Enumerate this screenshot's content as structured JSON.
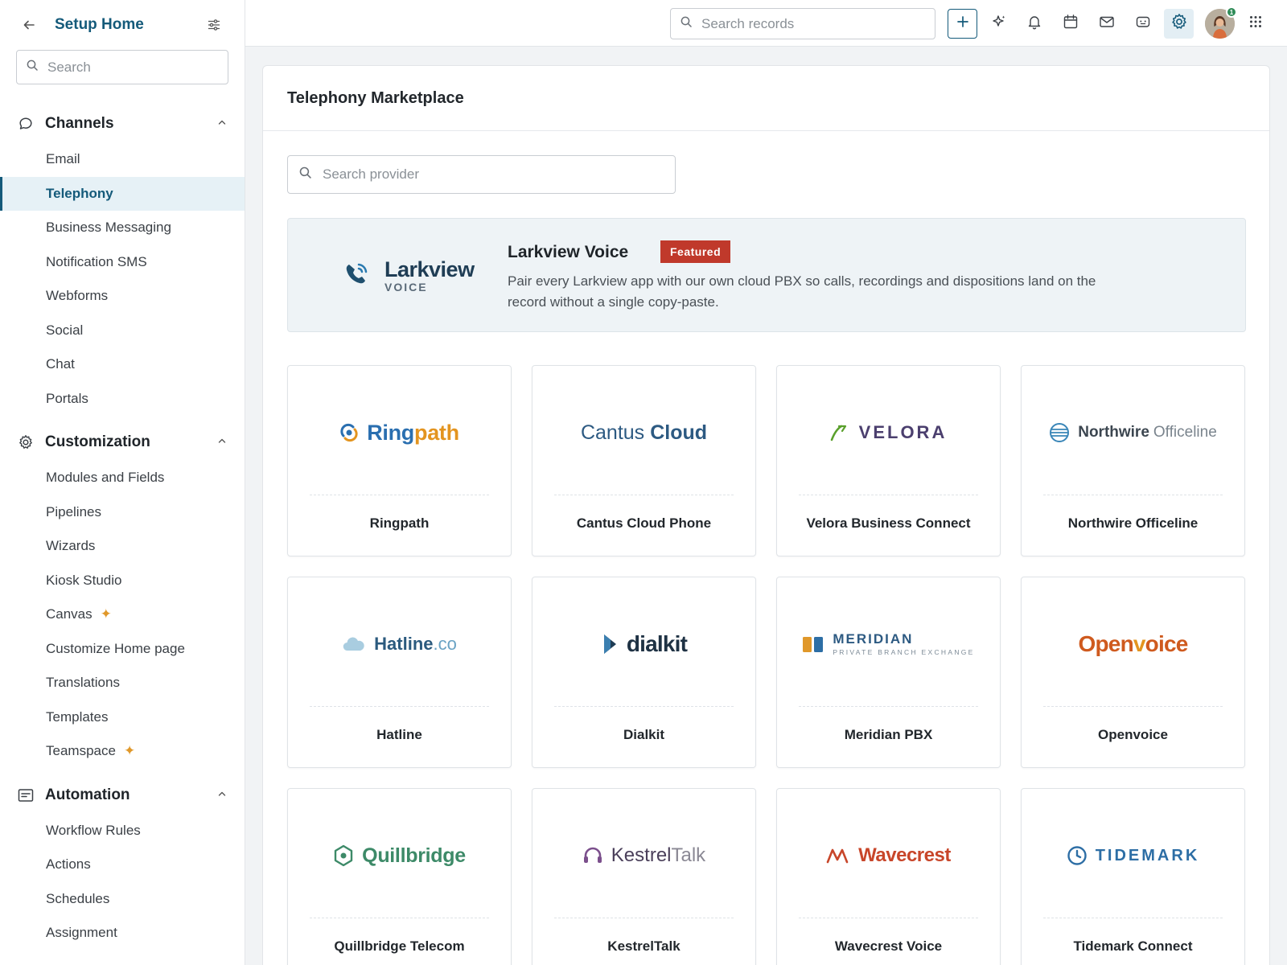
{
  "sidebar": {
    "title": "Setup Home",
    "search_placeholder": "Search",
    "sections": [
      {
        "label": "Channels",
        "items": [
          "Email",
          "Telephony",
          "Business Messaging",
          "Notification SMS",
          "Webforms",
          "Social",
          "Chat",
          "Portals"
        ]
      },
      {
        "label": "Customization",
        "items": [
          "Modules and Fields",
          "Pipelines",
          "Wizards",
          "Kiosk Studio",
          "Canvas",
          "Customize Home page",
          "Translations",
          "Templates",
          "Teamspace"
        ]
      },
      {
        "label": "Automation",
        "items": [
          "Workflow Rules",
          "Actions",
          "Schedules",
          "Assignment"
        ]
      }
    ],
    "active_item": "Telephony"
  },
  "topbar": {
    "search_placeholder": "Search records",
    "notification_count": "1"
  },
  "main": {
    "title": "Telephony Marketplace",
    "provider_search_placeholder": "Search provider",
    "featured": {
      "logo_word": "Larkview",
      "logo_sub": "VOICE",
      "name": "Larkview Voice",
      "badge": "Featured",
      "description": "Pair every Larkview app with our own cloud PBX so calls, recordings and dispositions land on the record without a single copy-paste."
    },
    "providers": [
      {
        "name": "Ringpath",
        "logo_a": "Ring",
        "logo_b": "path"
      },
      {
        "name": "Cantus Cloud Phone",
        "logo_a": "Cantus",
        "logo_b": "Cloud"
      },
      {
        "name": "Velora Business Connect",
        "logo_a": "VELORA"
      },
      {
        "name": "Northwire Officeline",
        "logo_a": "Northwire",
        "logo_b": "Officeline"
      },
      {
        "name": "Hatline",
        "logo_a": "Hatline",
        "logo_b": ".co"
      },
      {
        "name": "Dialkit",
        "logo_a": "dialkit"
      },
      {
        "name": "Meridian PBX",
        "logo_a": "MERIDIAN",
        "logo_b": "PRIVATE BRANCH EXCHANGE"
      },
      {
        "name": "Openvoice",
        "logo_a": "Open",
        "logo_b": "v",
        "logo_c": "oice"
      },
      {
        "name": "Quillbridge Telecom",
        "logo_a": "Quillbridge"
      },
      {
        "name": "KestrelTalk",
        "logo_a": "Kestrel",
        "logo_b": "Talk"
      },
      {
        "name": "Wavecrest Voice",
        "logo_a": "Wavecrest"
      },
      {
        "name": "Tidemark Connect",
        "logo_a": "TIDEMARK"
      }
    ]
  },
  "colors": {
    "brand": "#145a7a",
    "badge": "#c0392b",
    "spark": "#e0982a"
  },
  "icons": {
    "back": "arrow-left-icon",
    "filter": "sliders-icon",
    "search": "search-icon",
    "channels": "chat-bubble-icon",
    "customization": "gear-icon",
    "automation": "list-card-icon",
    "chevron": "chevron-up-icon"
  }
}
